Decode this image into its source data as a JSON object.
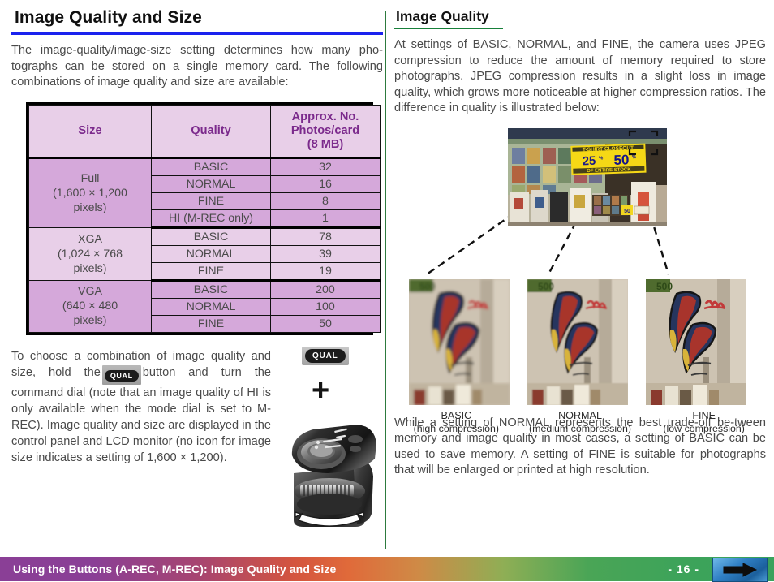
{
  "left": {
    "title": "Image Quality and Size",
    "intro": "The image-quality/image-size setting determines how many pho-tographs can be stored on a single memory card.  The following combinations of image quality and size are available:",
    "table": {
      "headers": [
        "Size",
        "Quality",
        "Approx. No. Photos/card (8 MB)"
      ],
      "header_num_line1": "Approx. No.",
      "header_num_line2": "Photos/card",
      "header_num_line3": "(8 MB)",
      "groups": [
        {
          "size_name": "Full",
          "size_dims": "(1,600 × 1,200",
          "size_units": "pixels)",
          "rows": [
            {
              "quality": "BASIC",
              "count": "32"
            },
            {
              "quality": "NORMAL",
              "count": "16"
            },
            {
              "quality": "FINE",
              "count": "8"
            },
            {
              "quality": "HI (M-REC only)",
              "count": "1"
            }
          ]
        },
        {
          "size_name": "XGA",
          "size_dims": "(1,024 × 768",
          "size_units": "pixels)",
          "rows": [
            {
              "quality": "BASIC",
              "count": "78"
            },
            {
              "quality": "NORMAL",
              "count": "39"
            },
            {
              "quality": "FINE",
              "count": "19"
            }
          ]
        },
        {
          "size_name": "VGA",
          "size_dims": "(640 × 480",
          "size_units": "pixels)",
          "rows": [
            {
              "quality": "BASIC",
              "count": "200"
            },
            {
              "quality": "NORMAL",
              "count": "100"
            },
            {
              "quality": "FINE",
              "count": "50"
            }
          ]
        }
      ]
    },
    "instructions_pre": "To choose a combination of image quality and size, hold the",
    "qual_button_label": "QUAL",
    "instructions_post": "button and turn the command dial (note that an image quality of HI is only available when the mode dial is set to M-REC).   Image quality and size are displayed in the control panel and LCD monitor (no icon for image size indicates a setting of 1,600 × 1,200).",
    "plus_symbol": "+"
  },
  "right": {
    "title": "Image Quality",
    "intro": "At settings of BASIC, NORMAL, and FINE, the camera uses JPEG compression to reduce the amount of memory required to store photographs.  JPEG compression results in a slight loss in image quality, which grows more noticeable at higher compression ratios. The difference in quality is illustrated below:",
    "photo_caption_signs": {
      "headline": "T-SHIRT CLOSEOUT",
      "percent1": "25",
      "percent2": "50",
      "subline": "OF ENTIRE STOCK"
    },
    "samples": [
      {
        "label": "BASIC",
        "sub": "(high compression)"
      },
      {
        "label": "NORMAL",
        "sub": "(medium compression)"
      },
      {
        "label": "FINE",
        "sub": "(low compression)"
      }
    ],
    "conclusion": "While a setting of NORMAL represents the best trade-off be-tween memory and image quality in most cases, a setting of BASIC can be used to save memory.  A setting of FINE is suitable for photographs that will be enlarged or printed at high resolution."
  },
  "footer": {
    "text": "Using the Buttons (A-REC, M-REC): Image Quality and Size",
    "page": "- 16 -",
    "next_icon": "right-arrow-icon"
  },
  "colors": {
    "left_rule": "#1a22ee",
    "right_rule": "#17803a",
    "table_header_text": "#7b2a8c",
    "table_band_dark": "#d5a8da",
    "table_band_light": "#e8cfe8",
    "divider": "#2d7a3e"
  }
}
